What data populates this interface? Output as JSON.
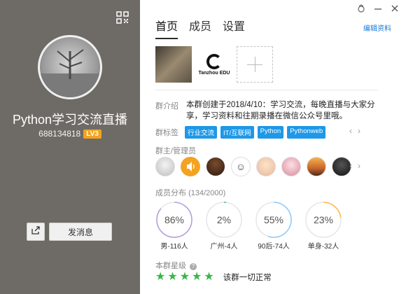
{
  "left": {
    "group_name": "Python学习交流直播",
    "group_id": "688134818",
    "level": "LV3",
    "send_message_label": "发消息"
  },
  "tabs": [
    {
      "label": "首页"
    },
    {
      "label": "成员"
    },
    {
      "label": "设置"
    }
  ],
  "header": {
    "edit_label": "编辑资料"
  },
  "photos": {
    "logo_text": "Tanzhou EDU"
  },
  "intro": {
    "label": "群介绍",
    "text": "本群创建于2018/4/10：学习交流，每晚直播与大家分享，学习资料和往期录播在微信公众号里哦。"
  },
  "tags": {
    "label": "群标签",
    "items": [
      "行业交流",
      "IT/互联网",
      "Python",
      "Pythonweb"
    ]
  },
  "admins": {
    "label": "群主/管理员"
  },
  "distribution": {
    "label": "成员分布",
    "count": "(134/2000)",
    "items": [
      {
        "percent": "86%",
        "value": 0.86,
        "caption": "男-116人",
        "color": "#b39ddb"
      },
      {
        "percent": "2%",
        "value": 0.02,
        "caption": "广州-4人",
        "color": "#4db6ac"
      },
      {
        "percent": "55%",
        "value": 0.55,
        "caption": "90后-74人",
        "color": "#90caf9"
      },
      {
        "percent": "23%",
        "value": 0.23,
        "caption": "单身-32人",
        "color": "#ffb74d"
      }
    ]
  },
  "rating": {
    "label": "本群星级",
    "stars": 5,
    "text": "该群一切正常"
  }
}
